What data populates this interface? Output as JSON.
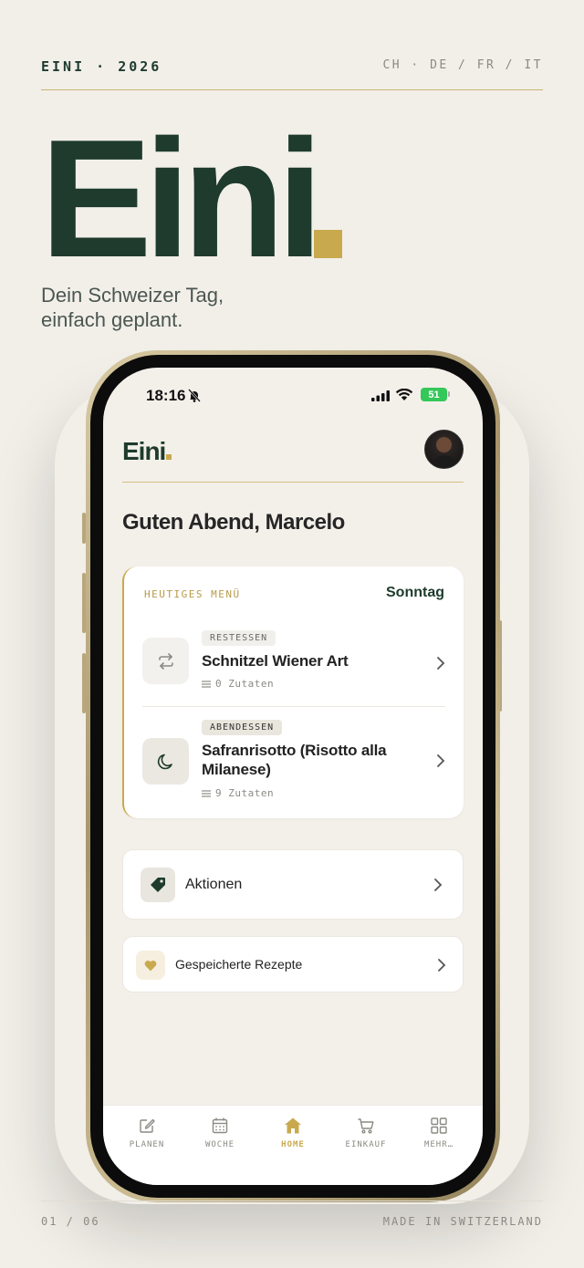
{
  "header": {
    "brand_year": "EINI · 2026",
    "languages": "CH · DE / FR / IT"
  },
  "hero": {
    "title": "Eini",
    "subtitle_line1": "Dein Schweizer Tag,",
    "subtitle_line2": "einfach geplant."
  },
  "status_bar": {
    "time": "18:16",
    "battery": "51"
  },
  "app": {
    "logo": "Eini",
    "greeting": "Guten Abend, Marcelo"
  },
  "menu": {
    "label": "HEUTIGES MENÜ",
    "day": "Sonntag",
    "meals": [
      {
        "tag": "RESTESSEN",
        "title": "Schnitzel Wiener Art",
        "ingredients": "0 Zutaten",
        "icon": "repeat-icon"
      },
      {
        "tag": "ABENDESSEN",
        "title": "Safranrisotto (Risotto alla Milanese)",
        "ingredients": "9 Zutaten",
        "icon": "moon-icon"
      }
    ]
  },
  "links": {
    "deals": "Aktionen",
    "saved": "Gespeicherte Rezepte"
  },
  "tabs": [
    {
      "label": "PLANEN",
      "icon": "edit-icon"
    },
    {
      "label": "WOCHE",
      "icon": "calendar-icon"
    },
    {
      "label": "HOME",
      "icon": "home-icon"
    },
    {
      "label": "EINKAUF",
      "icon": "cart-icon"
    },
    {
      "label": "MEHR…",
      "icon": "grid-icon"
    }
  ],
  "footer": {
    "page": "01 / 06",
    "made_in": "MADE IN SWITZERLAND"
  },
  "colors": {
    "primary": "#1e3b2d",
    "accent": "#c9a94e",
    "background": "#f2efe9"
  }
}
